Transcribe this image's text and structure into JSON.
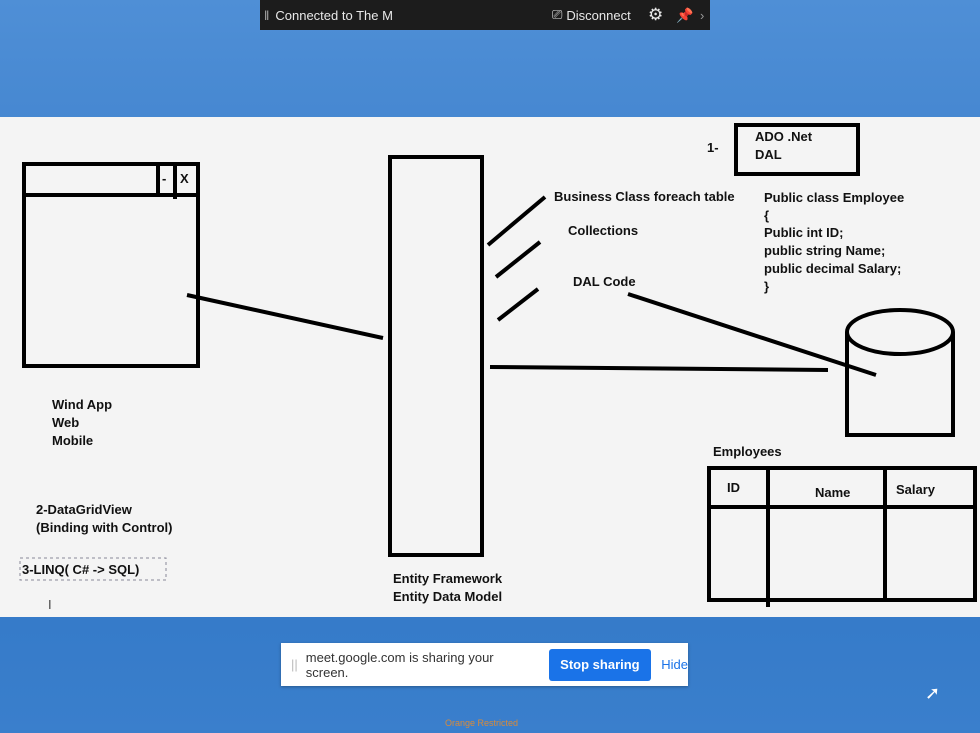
{
  "topbar": {
    "title": "Connected to The M",
    "disconnect": "Disconnect"
  },
  "board": {
    "window_controls": [
      "-",
      "X"
    ],
    "left_labels": [
      "Wind App",
      "Web",
      "Mobile"
    ],
    "item2": [
      "2-DataGridView",
      "(Binding with Control)"
    ],
    "item3": "3-LINQ( C# -> SQL)",
    "ef": [
      "Entity Framework",
      "Entity Data Model"
    ],
    "bullets": [
      "Business Class foreach table",
      "Collections",
      "DAL Code"
    ],
    "item1_num": "1-",
    "item1_box": [
      "ADO .Net",
      "DAL"
    ],
    "code": [
      "Public class Employee",
      "{",
      "Public int ID;",
      "public string Name;",
      "public decimal Salary;",
      "}"
    ],
    "table_title": "Employees",
    "table_headers": [
      "ID",
      "Name",
      "Salary"
    ]
  },
  "share_bar": {
    "message": "meet.google.com is sharing your screen.",
    "stop": "Stop sharing",
    "hide": "Hide"
  },
  "footer": "Orange Restricted"
}
